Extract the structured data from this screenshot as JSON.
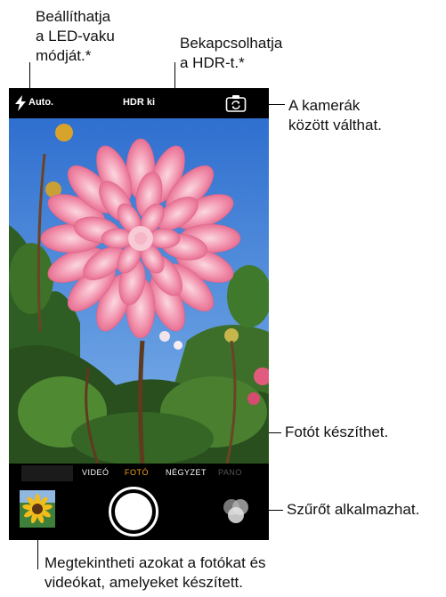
{
  "callouts": {
    "flash": [
      "Beállíthatja",
      "a LED-vaku",
      "módját.*"
    ],
    "hdr": [
      "Bekapcsolhatja",
      "a HDR-t.*"
    ],
    "switch_camera": [
      "A kamerák",
      "között válthat."
    ],
    "shutter": "Fotót készíthet.",
    "filters": "Szűrőt alkalmazhat.",
    "thumbnail": [
      "Megtekintheti azokat a fotókat és",
      "videókat, amelyeket készített."
    ]
  },
  "camera": {
    "flash_label": "Auto.",
    "hdr_label": "HDR ki",
    "modes": [
      "VIDEÓ",
      "FOTÓ",
      "NÉGYZET",
      "PANO"
    ],
    "active_mode": "FOTÓ"
  },
  "icons": {
    "flash": "lightning-bolt-icon",
    "switch_camera": "camera-rotate-icon",
    "filters": "overlapping-circles-icon"
  },
  "colors": {
    "active_mode": "#f2a11f",
    "sky": "#3f7fd6",
    "flower": "#ef8aa6"
  }
}
